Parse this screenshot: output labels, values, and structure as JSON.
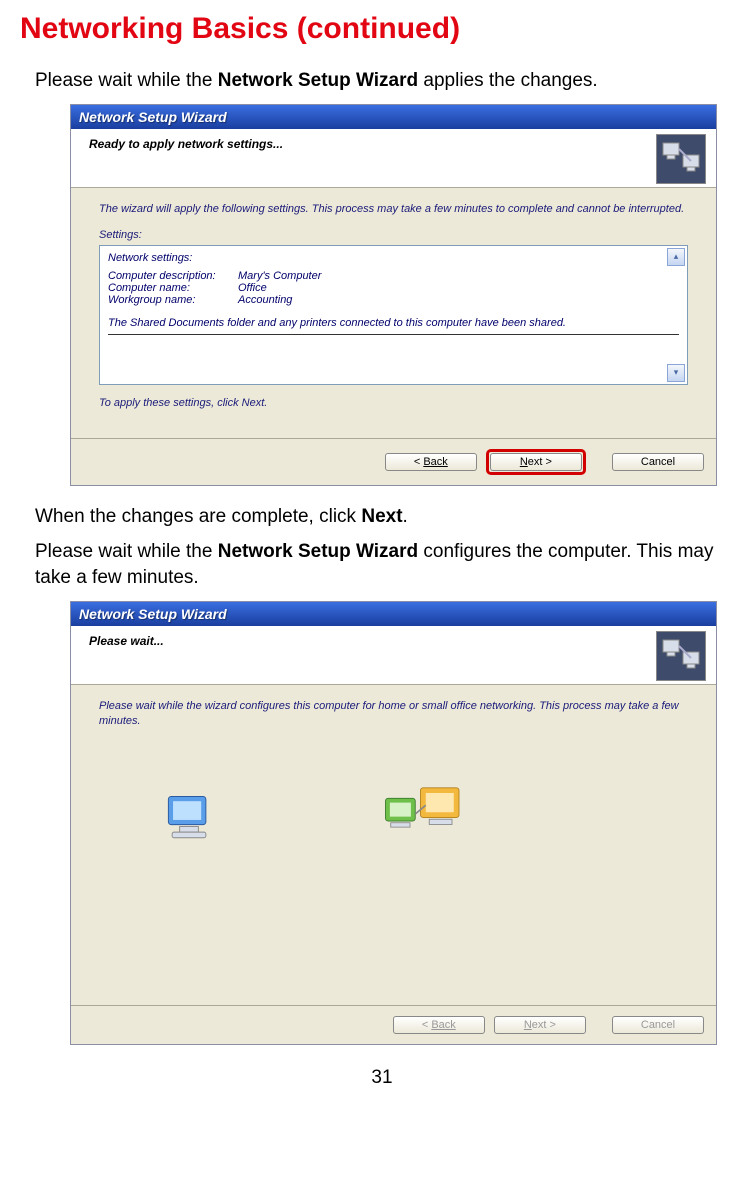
{
  "page": {
    "title": "Networking Basics (continued)",
    "intro1_pre": "Please wait while the ",
    "intro1_bold": "Network Setup Wizard",
    "intro1_post": " applies the changes.",
    "mid1_pre": "When the changes are complete, click ",
    "mid1_bold": "Next",
    "mid1_post": ".",
    "intro2_pre": "Please wait while the ",
    "intro2_bold": "Network Setup Wizard",
    "intro2_post": " configures the computer. This may take a few minutes.",
    "page_number": "31"
  },
  "wizard1": {
    "titlebar": "Network Setup Wizard",
    "header": "Ready to apply network settings...",
    "intro": "The wizard will apply the following settings. This process may take a few minutes to complete and cannot be interrupted.",
    "settings_label": "Settings:",
    "box_title": "Network settings:",
    "rows": [
      {
        "k": "Computer description:",
        "v": "Mary's Computer"
      },
      {
        "k": "Computer name:",
        "v": "Office"
      },
      {
        "k": "Workgroup name:",
        "v": "Accounting"
      }
    ],
    "shared_text": "The Shared Documents folder and any printers connected to this computer have been shared.",
    "apply_hint": "To apply these settings, click Next.",
    "buttons": {
      "back": "Back",
      "next": "Next >",
      "cancel": "Cancel"
    }
  },
  "wizard2": {
    "titlebar": "Network Setup Wizard",
    "header": "Please wait...",
    "intro": "Please wait while the wizard configures this computer for home or small office networking. This process may take a few minutes.",
    "buttons": {
      "back": "Back",
      "next": "Next >",
      "cancel": "Cancel"
    }
  }
}
